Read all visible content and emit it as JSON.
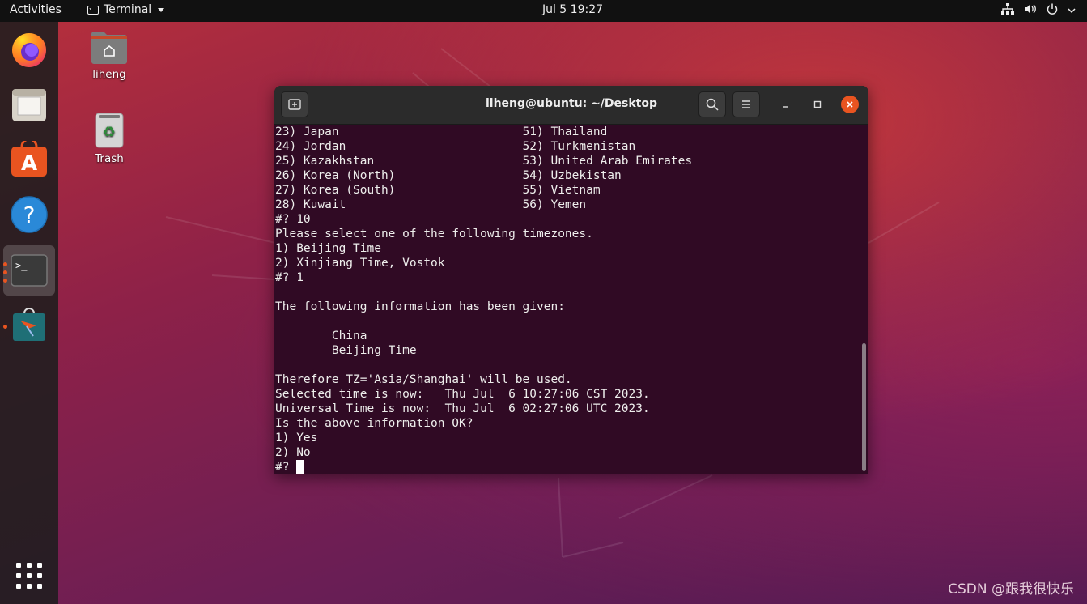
{
  "topbar": {
    "activities": "Activities",
    "app_name": "Terminal",
    "clock": "Jul 5  19:27"
  },
  "desktop": {
    "home_label": "liheng",
    "trash_label": "Trash"
  },
  "window": {
    "title": "liheng@ubuntu: ~/Desktop"
  },
  "terminal": {
    "lines": [
      "23) Japan                          51) Thailand",
      "24) Jordan                         52) Turkmenistan",
      "25) Kazakhstan                     53) United Arab Emirates",
      "26) Korea (North)                  54) Uzbekistan",
      "27) Korea (South)                  55) Vietnam",
      "28) Kuwait                         56) Yemen",
      "#? 10",
      "Please select one of the following timezones.",
      "1) Beijing Time",
      "2) Xinjiang Time, Vostok",
      "#? 1",
      "",
      "The following information has been given:",
      "",
      "        China",
      "        Beijing Time",
      "",
      "Therefore TZ='Asia/Shanghai' will be used.",
      "Selected time is now:   Thu Jul  6 10:27:06 CST 2023.",
      "Universal Time is now:  Thu Jul  6 02:27:06 UTC 2023.",
      "Is the above information OK?",
      "1) Yes",
      "2) No"
    ],
    "prompt": "#? "
  },
  "watermark": "CSDN @跟我很快乐",
  "colors": {
    "terminal_bg": "#300a24",
    "accent": "#e95420",
    "titlebar": "#2b2b2b"
  }
}
